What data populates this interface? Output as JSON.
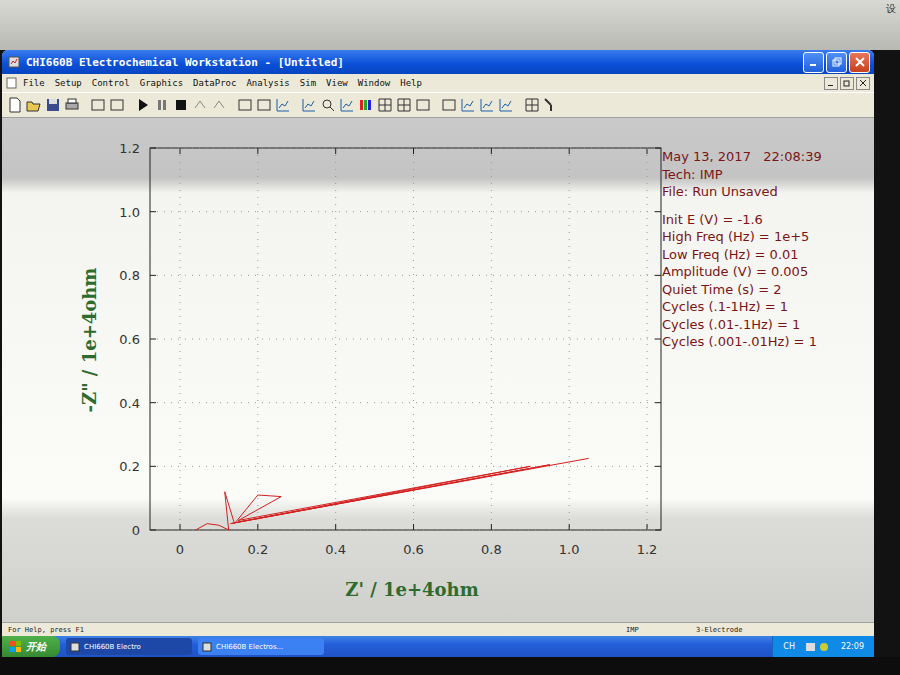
{
  "window": {
    "title": "CHI660B Electrochemical Workstation - [Untitled]"
  },
  "menu": [
    "File",
    "Setup",
    "Control",
    "Graphics",
    "DataProc",
    "Analysis",
    "Sim",
    "View",
    "Window",
    "Help"
  ],
  "chart": {
    "x_axis": {
      "label": "Z' / 1e+4ohm",
      "ticks": [
        "0",
        "0.2",
        "0.4",
        "0.6",
        "0.8",
        "1.0",
        "1.2"
      ]
    },
    "y_axis": {
      "label": "-Z\" / 1e+4ohm",
      "ticks": [
        "0",
        "0.2",
        "0.4",
        "0.6",
        "0.8",
        "1.0",
        "1.2"
      ]
    },
    "series": [
      {
        "name": "impedance",
        "z_real": [
          0.04,
          0.07,
          0.1,
          0.125,
          0.115,
          0.14,
          0.2,
          0.26,
          0.15,
          0.9,
          0.13,
          0.95,
          0.15,
          1.05
        ],
        "z_imag": [
          0.0,
          0.02,
          0.015,
          0.0,
          0.12,
          0.02,
          0.11,
          0.105,
          0.03,
          0.2,
          0.02,
          0.205,
          0.025,
          0.225
        ]
      }
    ]
  },
  "info": {
    "header": [
      "May 13, 2017   22:08:39",
      "Tech: IMP",
      "File: Run Unsaved"
    ],
    "params": [
      "Init E (V) = -1.6",
      "High Freq (Hz) = 1e+5",
      "Low Freq (Hz) = 0.01",
      "Amplitude (V) = 0.005",
      "Quiet Time (s) = 2",
      "Cycles (.1-1Hz) = 1",
      "Cycles (.01-.1Hz) = 1",
      "Cycles (.001-.01Hz) = 1"
    ]
  },
  "status_bar": [
    "For Help, press F1",
    "IMP",
    "3-Electrode"
  ],
  "taskbar": {
    "start": "开始",
    "tasks": [
      {
        "label": "CHI660B Electro",
        "selected": true
      },
      {
        "label": "CHI660B Electros...",
        "selected": false
      }
    ],
    "tray": [
      "CH",
      "22:09"
    ]
  },
  "corner_text": "设"
}
